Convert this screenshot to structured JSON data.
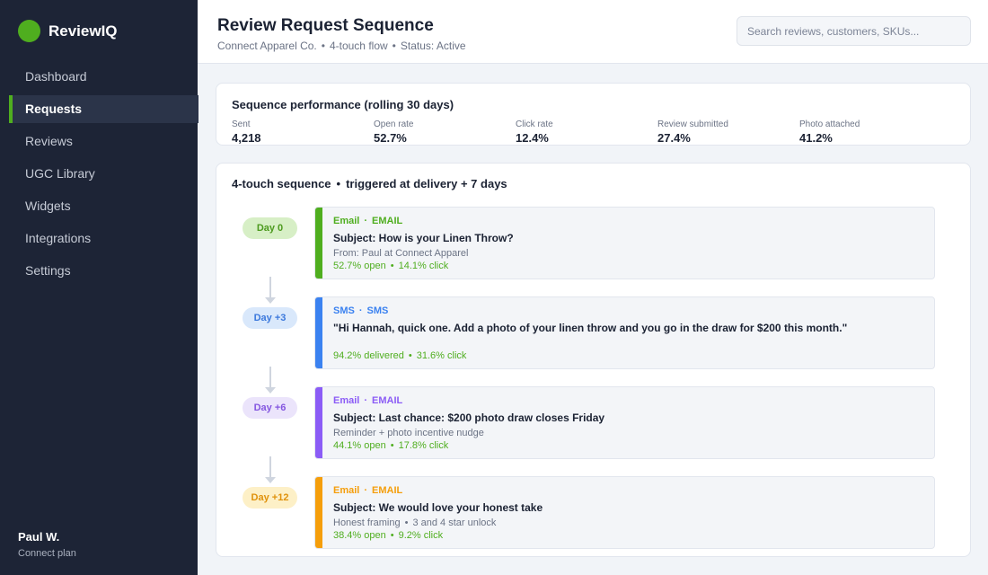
{
  "app": {
    "name": "ReviewIQ"
  },
  "sidebar": {
    "items": [
      {
        "label": "Dashboard"
      },
      {
        "label": "Requests"
      },
      {
        "label": "Reviews"
      },
      {
        "label": "UGC Library"
      },
      {
        "label": "Widgets"
      },
      {
        "label": "Integrations"
      },
      {
        "label": "Settings"
      }
    ],
    "active_index": 1,
    "user": {
      "name": "Paul W.",
      "plan": "Connect plan"
    }
  },
  "header": {
    "title": "Review Request Sequence",
    "client": "Connect Apparel Co.",
    "flow": "4-touch flow",
    "status": "Status: Active",
    "separator": "•",
    "search_placeholder": "Search reviews, customers, SKUs..."
  },
  "performance": {
    "title": "Sequence performance  (rolling 30 days)",
    "metrics": [
      {
        "label": "Sent",
        "value": "4,218"
      },
      {
        "label": "Open rate",
        "value": "52.7%"
      },
      {
        "label": "Click rate",
        "value": "12.4%"
      },
      {
        "label": "Review submitted",
        "value": "27.4%"
      },
      {
        "label": "Photo attached",
        "value": "41.2%"
      }
    ]
  },
  "sequence": {
    "title_main": "4-touch sequence",
    "title_trigger": "triggered at delivery + 7 days",
    "separator": "•",
    "channel_dot": "·",
    "steps": [
      {
        "day": "Day 0",
        "channel": "Email",
        "channel_type": "EMAIL",
        "subject": "Subject: How is your Linen Throw?",
        "meta": [
          "From: Paul at Connect Apparel"
        ],
        "stats": [
          "52.7% open",
          "14.1% click"
        ],
        "accent": "#4fae1f",
        "pill_bg": "#d7efc6",
        "pill_fg": "#4c9a1e"
      },
      {
        "day": "Day +3",
        "channel": "SMS",
        "channel_type": "SMS",
        "subject": "\"Hi Hannah, quick one. Add a photo of your linen throw and you go in the draw for $200 this month.\"",
        "meta": [],
        "stats": [
          "94.2% delivered",
          "31.6% click"
        ],
        "accent": "#3b82f0",
        "pill_bg": "#d9e8fb",
        "pill_fg": "#3b78dc"
      },
      {
        "day": "Day +6",
        "channel": "Email",
        "channel_type": "EMAIL",
        "subject": "Subject: Last chance: $200 photo draw closes Friday",
        "meta": [
          "Reminder + photo incentive nudge"
        ],
        "stats": [
          "44.1% open",
          "17.8% click"
        ],
        "accent": "#8b5cf6",
        "pill_bg": "#ebe4fb",
        "pill_fg": "#8456e0"
      },
      {
        "day": "Day +12",
        "channel": "Email",
        "channel_type": "EMAIL",
        "subject": "Subject: We would love your honest take",
        "meta": [
          "Honest framing",
          "3 and 4 star unlock"
        ],
        "stats": [
          "38.4% open",
          "9.2% click"
        ],
        "accent": "#f59e0b",
        "pill_bg": "#fdf0c7",
        "pill_fg": "#e0920c"
      }
    ]
  }
}
